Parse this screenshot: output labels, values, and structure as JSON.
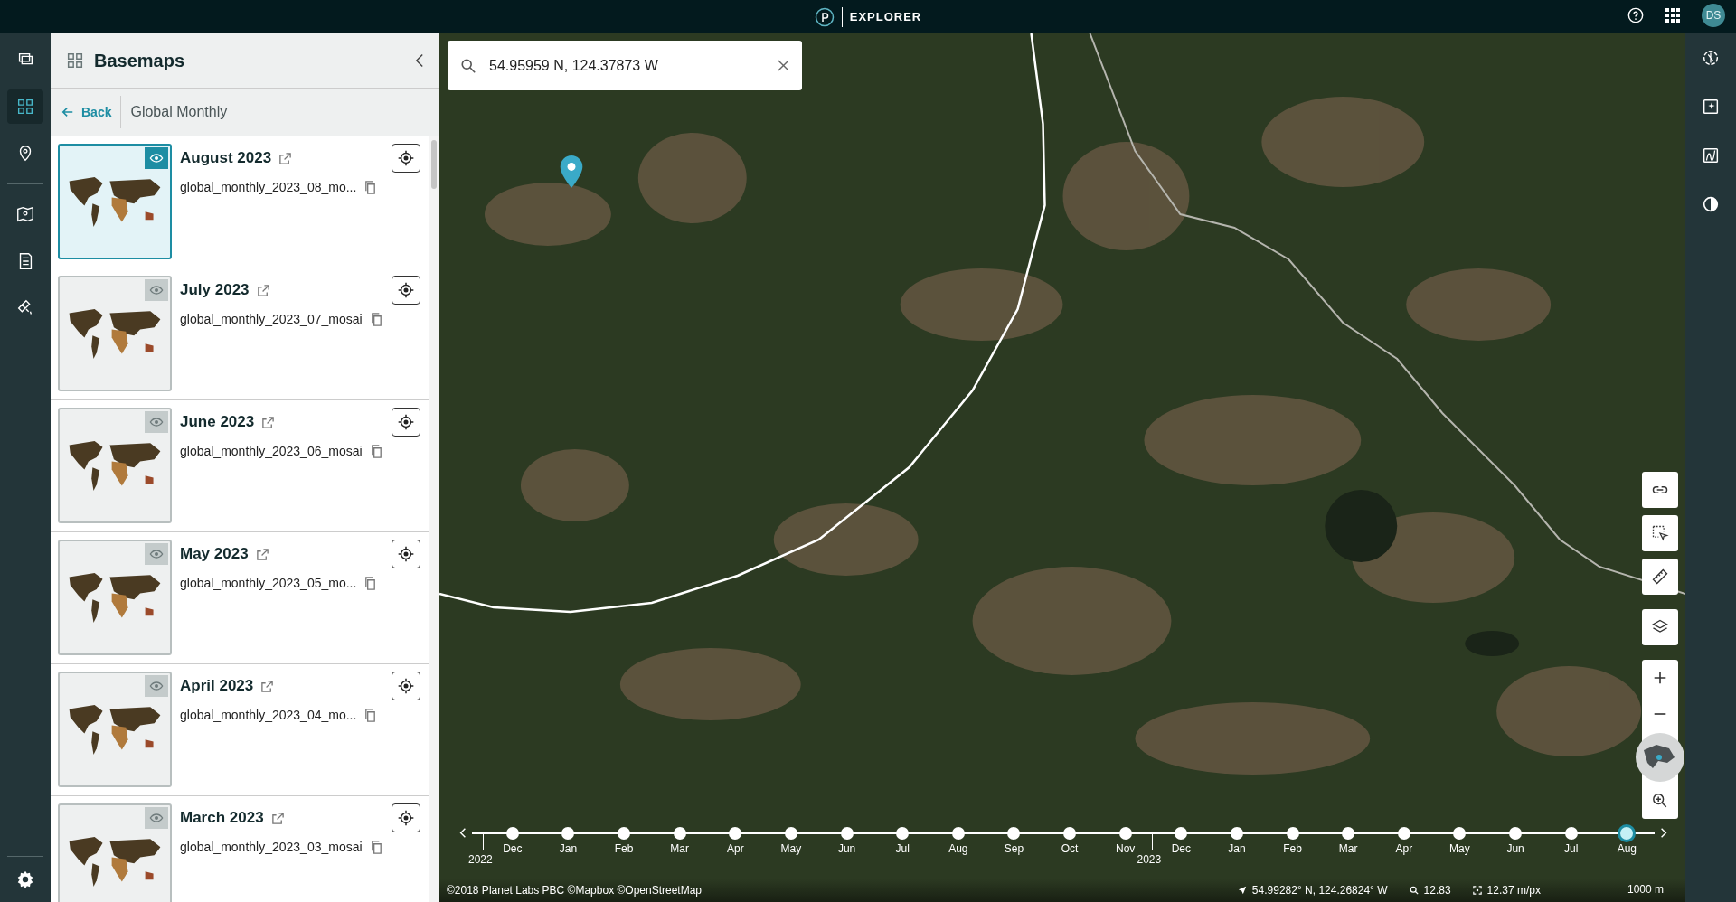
{
  "top_bar": {
    "app_title": "EXPLORER",
    "avatar_initials": "DS"
  },
  "left_rail": {
    "items": [
      {
        "kind": "stack",
        "selected": false
      },
      {
        "kind": "basemaps",
        "selected": true
      },
      {
        "kind": "pin",
        "selected": false
      },
      {
        "kind": "map",
        "selected": false
      },
      {
        "kind": "list",
        "selected": false
      },
      {
        "kind": "satellite",
        "selected": false
      }
    ]
  },
  "panel": {
    "title": "Basemaps",
    "back_label": "Back",
    "breadcrumb": "Global Monthly",
    "items": [
      {
        "title": "August 2023",
        "mosaic": "global_monthly_2023_08_mo...",
        "visible": true,
        "selected": true
      },
      {
        "title": "July 2023",
        "mosaic": "global_monthly_2023_07_mosai",
        "visible": false,
        "selected": false
      },
      {
        "title": "June 2023",
        "mosaic": "global_monthly_2023_06_mosai",
        "visible": false,
        "selected": false
      },
      {
        "title": "May 2023",
        "mosaic": "global_monthly_2023_05_mo...",
        "visible": false,
        "selected": false
      },
      {
        "title": "April 2023",
        "mosaic": "global_monthly_2023_04_mo...",
        "visible": false,
        "selected": false
      },
      {
        "title": "March 2023",
        "mosaic": "global_monthly_2023_03_mosai",
        "visible": false,
        "selected": false
      }
    ]
  },
  "search": {
    "value": "54.95959 N, 124.37873 W"
  },
  "timeline": {
    "months": [
      {
        "label": "Dec",
        "year": "2022",
        "selected": false
      },
      {
        "label": "Jan",
        "selected": false
      },
      {
        "label": "Feb",
        "selected": false
      },
      {
        "label": "Mar",
        "selected": false
      },
      {
        "label": "Apr",
        "selected": false
      },
      {
        "label": "May",
        "selected": false
      },
      {
        "label": "Jun",
        "selected": false
      },
      {
        "label": "Jul",
        "selected": false
      },
      {
        "label": "Aug",
        "selected": false
      },
      {
        "label": "Sep",
        "selected": false
      },
      {
        "label": "Oct",
        "selected": false
      },
      {
        "label": "Nov",
        "selected": false
      },
      {
        "label": "Dec",
        "year": "2023",
        "selected": false
      },
      {
        "label": "Jan",
        "selected": false
      },
      {
        "label": "Feb",
        "selected": false
      },
      {
        "label": "Mar",
        "selected": false
      },
      {
        "label": "Apr",
        "selected": false
      },
      {
        "label": "May",
        "selected": false
      },
      {
        "label": "Jun",
        "selected": false
      },
      {
        "label": "Jul",
        "selected": false
      },
      {
        "label": "Aug",
        "selected": true
      }
    ]
  },
  "status_bar": {
    "attribution": "©2018 Planet Labs PBC ©Mapbox ©OpenStreetMap",
    "cursor_coordinates": "54.99282° N, 124.26824° W",
    "zoom_level": "12.83",
    "resolution": "12.37 m/px",
    "scale": "1000 m"
  }
}
